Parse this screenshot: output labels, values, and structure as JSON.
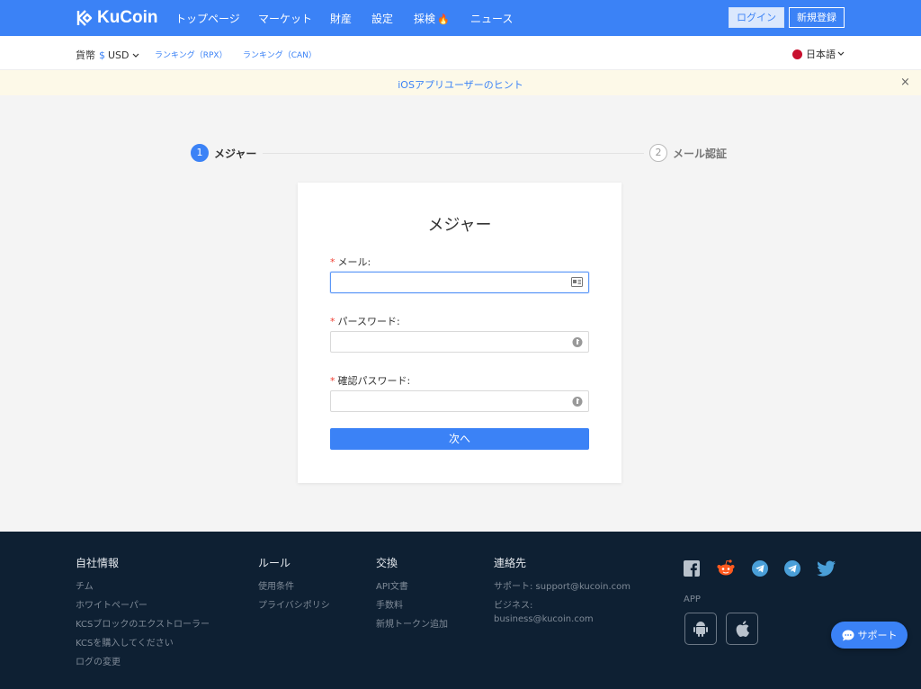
{
  "nav": {
    "logo": "KuCoin",
    "items": [
      "トップページ",
      "マーケット",
      "財産",
      "設定",
      "採検",
      "ニュース"
    ],
    "login": "ログイン",
    "register": "新規登録"
  },
  "subbar": {
    "currency_label": "貨幣",
    "currency_symbol": "$",
    "currency_value": "USD",
    "ranking_rpx": "ランキング（RPX）",
    "ranking_can": "ランキング（CAN）",
    "language": "日本語"
  },
  "notice": {
    "text": "iOSアプリユーザーのヒント",
    "close": "×"
  },
  "steps": [
    {
      "num": "1",
      "label": "メジャー"
    },
    {
      "num": "2",
      "label": "メール認証"
    }
  ],
  "form": {
    "title": "メジャー",
    "required_mark": "*",
    "email_label": "メール:",
    "email_value": "",
    "password_label": "パースワード:",
    "password_value": "",
    "confirm_label": "確認パスワード:",
    "confirm_value": "",
    "next": "次へ"
  },
  "footer": {
    "about": {
      "title": "自社情報",
      "links": [
        "チム",
        "ホワイトペーパー",
        "KCSブロックのエクストローラー",
        "KCSを購入してください",
        "ログの変更"
      ]
    },
    "rules": {
      "title": "ルール",
      "links": [
        "使用条件",
        "プライバシポリシ"
      ]
    },
    "exchange": {
      "title": "交換",
      "links": [
        "API文書",
        "手数料",
        "新規トークン追加"
      ]
    },
    "contact": {
      "title": "連絡先",
      "support": "サポート:  support@kucoin.com",
      "business_label": "ビジネス:",
      "business_email": "business@kucoin.com"
    },
    "app_label": "APP",
    "social_icons": [
      "facebook-icon",
      "reddit-icon",
      "telegram-icon",
      "telegram-icon",
      "twitter-icon"
    ]
  },
  "support_button": "サポート",
  "colors": {
    "primary": "#3b82f6",
    "footer_bg": "#0e2033",
    "notice_bg": "#fdf9e8",
    "required": "#f04134"
  }
}
